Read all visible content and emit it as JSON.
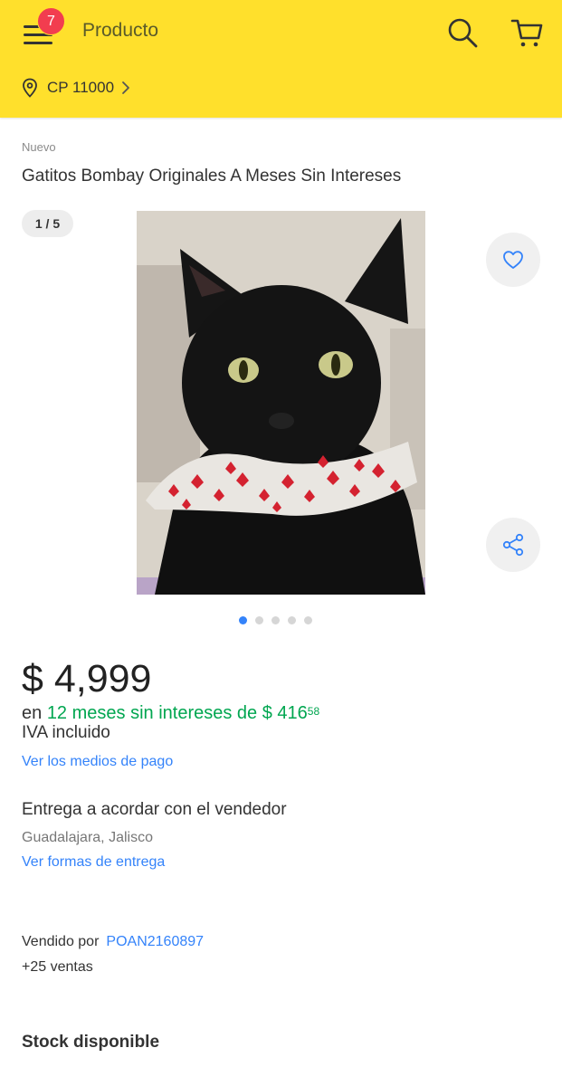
{
  "header": {
    "badge_count": "7",
    "title": "Producto",
    "icons": [
      "menu-icon",
      "search-icon",
      "cart-icon"
    ],
    "location_icon": "location-pin-icon",
    "location_label": "CP 11000"
  },
  "product": {
    "condition": "Nuevo",
    "title": "Gatitos Bombay Originales A Meses Sin Intereses",
    "image_counter": "1 / 5",
    "gallery_total": 5,
    "gallery_active_index": 1,
    "price": "$ 4,999",
    "installments_prefix": "en",
    "installments_text": "12 meses sin intereses de $ 416",
    "installments_cents": "58",
    "tax_note": "IVA incluido",
    "payment_link": "Ver los medios de pago"
  },
  "delivery": {
    "title": "Entrega a acordar con el vendedor",
    "location": "Guadalajara, Jalisco",
    "link": "Ver formas de entrega"
  },
  "seller": {
    "label": "Vendido por",
    "name": "POAN2160897",
    "sales": "+25 ventas"
  },
  "stock": {
    "title": "Stock disponible"
  },
  "colors": {
    "header_bg": "#ffe02c",
    "badge": "#f23d4f",
    "link": "#3483fa",
    "green": "#00a650"
  }
}
